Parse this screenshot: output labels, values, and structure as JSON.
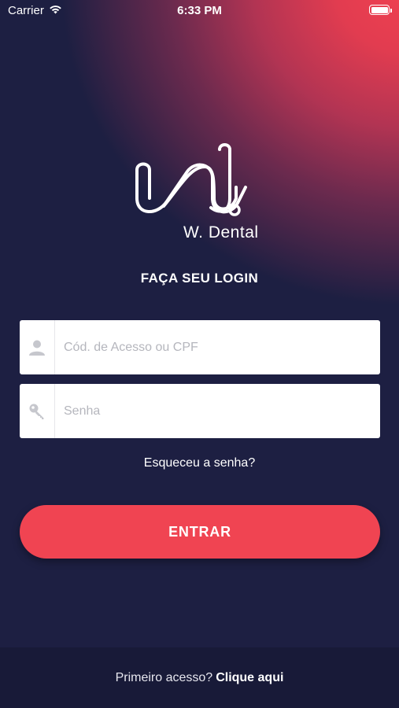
{
  "status_bar": {
    "carrier": "Carrier",
    "time": "6:33 PM",
    "icons": [
      "wifi-icon",
      "battery-icon"
    ]
  },
  "brand": {
    "logo_text": "W. Dental"
  },
  "login": {
    "title": "FAÇA SEU LOGIN",
    "user_field": {
      "placeholder": "Cód. de Acesso ou CPF",
      "value": "",
      "icon": "user-icon"
    },
    "password_field": {
      "placeholder": "Senha",
      "value": "",
      "icon": "key-icon"
    },
    "forgot_label": "Esqueceu a senha?",
    "submit_label": "ENTRAR"
  },
  "footer": {
    "prompt": "Primeiro acesso?",
    "link_label": "Clique aqui"
  },
  "colors": {
    "background": "#1d1f42",
    "accent": "#f04452",
    "footer_background": "#181a38"
  }
}
